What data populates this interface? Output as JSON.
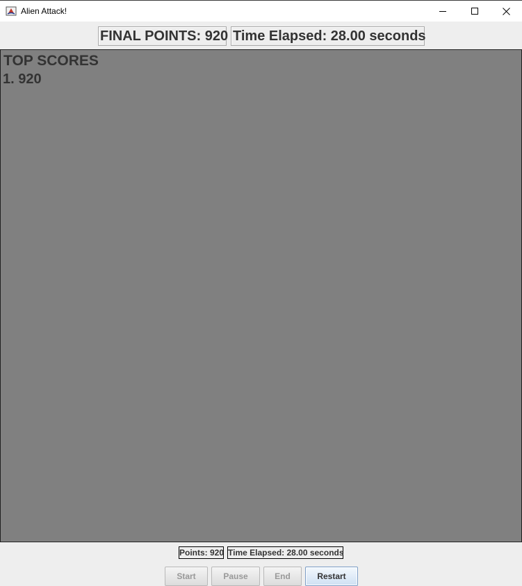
{
  "window": {
    "title": "Alien Attack!",
    "app_icon": "java-app-icon",
    "controls": {
      "minimize_icon": "minimize-icon",
      "maximize_icon": "maximize-icon",
      "close_icon": "close-icon"
    }
  },
  "header": {
    "final_points": "FINAL POINTS: 920",
    "time_elapsed": "Time Elapsed: 28.00 seconds"
  },
  "game": {
    "background_color": "#808080",
    "top_scores_title": "TOP SCORES",
    "scores": [
      "1. 920"
    ]
  },
  "status": {
    "points": "Points: 920",
    "time_elapsed": "Time Elapsed: 28.00 seconds"
  },
  "controls": {
    "start_label": "Start",
    "pause_label": "Pause",
    "end_label": "End",
    "restart_label": "Restart"
  },
  "colors": {
    "panel": "#eeeeee",
    "game_area": "#808080",
    "text": "#333333",
    "disabled_text": "#999999",
    "active_button_border": "#7a9cc6"
  }
}
